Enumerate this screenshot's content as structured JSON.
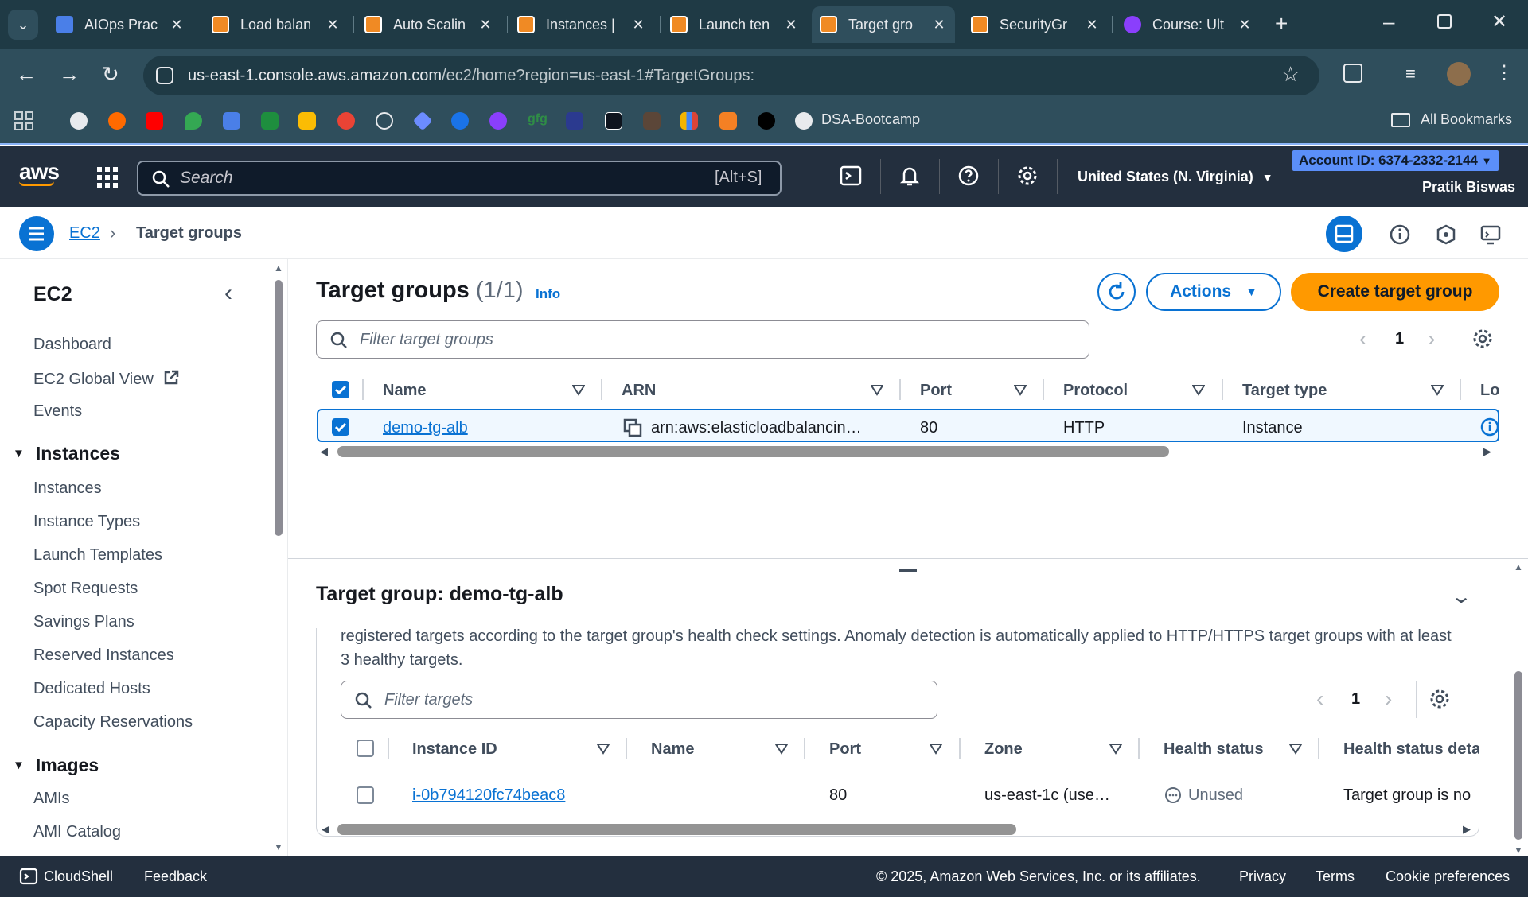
{
  "browser": {
    "tabs": [
      {
        "title": "AIOps Prac",
        "favicon": "docs-icon"
      },
      {
        "title": "Load balan",
        "favicon": "aws-icon"
      },
      {
        "title": "Auto Scalin",
        "favicon": "aws-icon"
      },
      {
        "title": "Instances |",
        "favicon": "aws-icon"
      },
      {
        "title": "Launch ten",
        "favicon": "aws-icon"
      },
      {
        "title": "Target gro",
        "favicon": "aws-icon",
        "active": true
      },
      {
        "title": "SecurityGr",
        "favicon": "aws-icon"
      },
      {
        "title": "Course: Ult",
        "favicon": "udemy-icon"
      }
    ],
    "url_host": "us-east-1.console.aws.amazon.com",
    "url_path": "/ec2/home?region=us-east-1#TargetGroups:",
    "bookmarks": {
      "named": "DSA-Bootcamp",
      "all": "All Bookmarks"
    }
  },
  "aws_header": {
    "logo": "aws",
    "search_placeholder": "Search",
    "search_shortcut": "[Alt+S]",
    "region": "United States (N. Virginia)",
    "account": "Account ID: 6374-2332-2144",
    "user": "Pratik Biswas"
  },
  "breadcrumb": {
    "root": "EC2",
    "current": "Target groups"
  },
  "sidenav": {
    "title": "EC2",
    "top_links": [
      "Dashboard",
      "EC2 Global View",
      "Events"
    ],
    "sections": [
      {
        "title": "Instances",
        "items": [
          "Instances",
          "Instance Types",
          "Launch Templates",
          "Spot Requests",
          "Savings Plans",
          "Reserved Instances",
          "Dedicated Hosts",
          "Capacity Reservations"
        ]
      },
      {
        "title": "Images",
        "items": [
          "AMIs",
          "AMI Catalog"
        ]
      }
    ]
  },
  "target_groups": {
    "title": "Target groups",
    "count": "(1/1)",
    "info": "Info",
    "actions_label": "Actions",
    "create_label": "Create target group",
    "filter_placeholder": "Filter target groups",
    "page": "1",
    "columns": [
      "Name",
      "ARN",
      "Port",
      "Protocol",
      "Target type",
      "Lo"
    ],
    "rows": [
      {
        "name": "demo-tg-alb",
        "arn": "arn:aws:elasticloadbalancin…",
        "port": "80",
        "protocol": "HTTP",
        "target_type": "Instance"
      }
    ]
  },
  "details": {
    "title": "Target group: demo-tg-alb",
    "description": "registered targets according to the target group's health check settings. Anomaly detection is automatically applied to HTTP/HTTPS target groups with at least 3 healthy targets.",
    "filter_placeholder": "Filter targets",
    "page": "1",
    "columns": [
      "Instance ID",
      "Name",
      "Port",
      "Zone",
      "Health status",
      "Health status deta"
    ],
    "rows": [
      {
        "instance_id": "i-0b794120fc74beac8",
        "name": "",
        "port": "80",
        "zone": "us-east-1c (use…",
        "health": "Unused",
        "health_detail": "Target group is no"
      }
    ]
  },
  "footer": {
    "cloudshell": "CloudShell",
    "feedback": "Feedback",
    "copyright": "© 2025, Amazon Web Services, Inc. or its affiliates.",
    "privacy": "Privacy",
    "terms": "Terms",
    "cookies": "Cookie preferences"
  },
  "colors": {
    "aws_nav": "#232f3e",
    "primary": "#0972d3",
    "create_button": "#ff9900",
    "browser_frame": "#1f3a45"
  }
}
